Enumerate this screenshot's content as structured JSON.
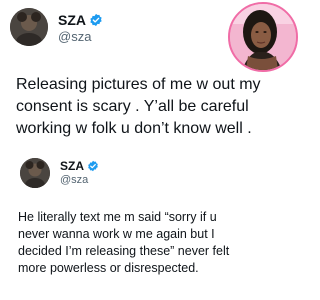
{
  "top_tweet": {
    "display_name": "SZA",
    "handle": "@sza",
    "verified": true,
    "text_lines": [
      "Releasing pictures of me w out my",
      "consent is scary . Y’all be careful",
      "working w folk u don’t know well ."
    ]
  },
  "bottom_tweet": {
    "display_name": "SZA",
    "handle": "@sza",
    "verified": true,
    "text_lines": [
      "He literally text me m said “sorry if u",
      "never wanna work w me again but I",
      "decided I’m releasing these” never felt",
      "more powerless or disrespected."
    ]
  },
  "icons": {
    "verified": "verified-badge-icon",
    "avatar": "profile-avatar",
    "inset": "inset-photo"
  },
  "colors": {
    "verified_blue": "#1d9bf0",
    "text": "#0f1419",
    "muted": "#536471",
    "inset_border": "#f06ca6"
  }
}
